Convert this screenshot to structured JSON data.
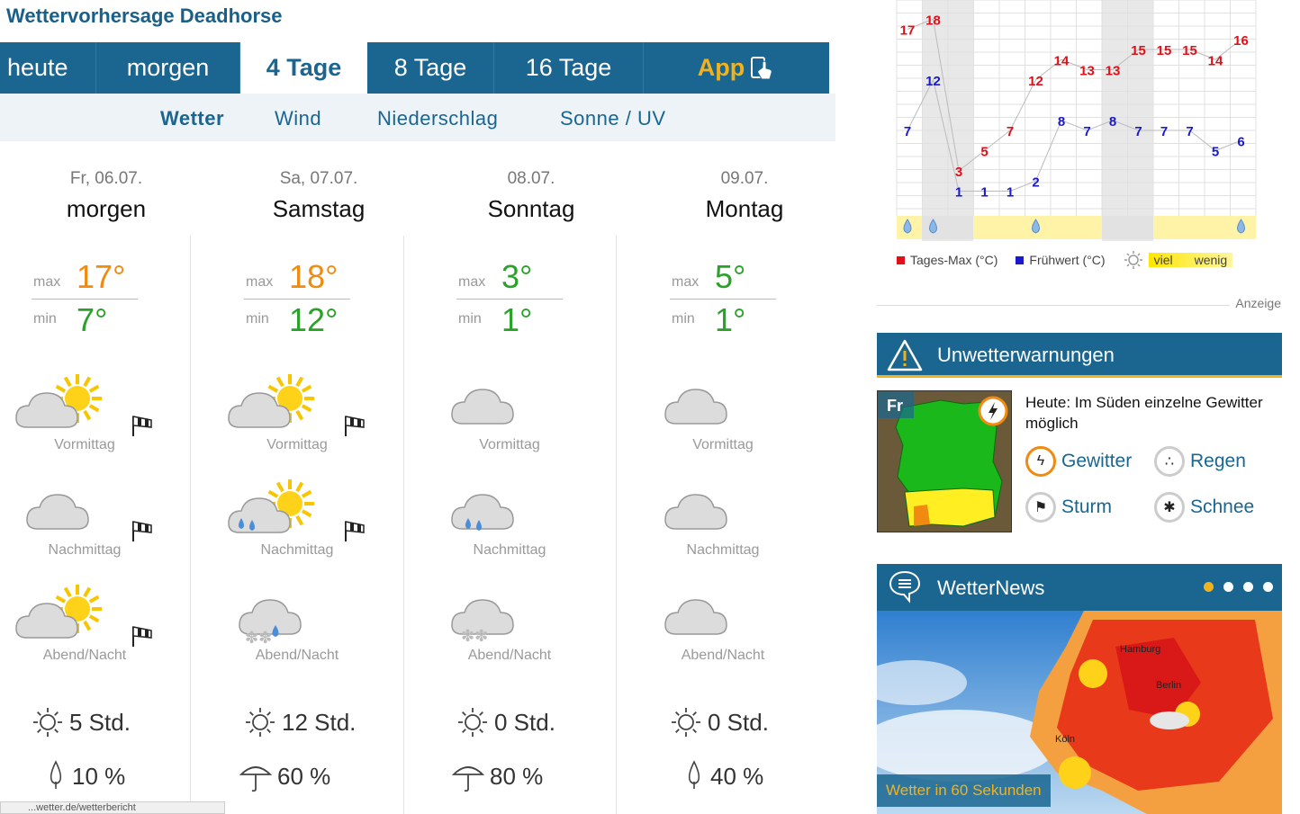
{
  "page": {
    "title": "Wettervorhersage Deadhorse"
  },
  "tabs": [
    {
      "label": "heute"
    },
    {
      "label": "morgen"
    },
    {
      "label": "4 Tage"
    },
    {
      "label": "8 Tage"
    },
    {
      "label": "16 Tage"
    },
    {
      "label": "App"
    }
  ],
  "subtabs": [
    {
      "label": "Wetter"
    },
    {
      "label": "Wind"
    },
    {
      "label": "Niederschlag"
    },
    {
      "label": "Sonne / UV"
    }
  ],
  "labels": {
    "max": "max",
    "min": "min"
  },
  "days": [
    {
      "date": "Fr, 06.07.",
      "name": "morgen",
      "max": "17°",
      "min": "7°",
      "periods": [
        "Vormittag",
        "Nachmittag",
        "Abend/Nacht"
      ],
      "icons": [
        "sun-cloud-icon",
        "cloud-icon",
        "sun-cloud-icon"
      ],
      "wind_icons": [
        "windsock-icon",
        "windsock-icon",
        "windsock-icon"
      ],
      "sun": "5 Std.",
      "rain": "10 %",
      "rain_icon": "drop-icon"
    },
    {
      "date": "Sa, 07.07.",
      "name": "Samstag",
      "max": "18°",
      "min": "12°",
      "periods": [
        "Vormittag",
        "Nachmittag",
        "Abend/Nacht"
      ],
      "icons": [
        "sun-cloud-icon",
        "sun-cloud-rain-icon",
        "cloud-snow-rain-icon"
      ],
      "wind_icons": [
        "windsock-icon",
        "windsock-icon"
      ],
      "sun": "12 Std.",
      "rain": "60 %",
      "rain_icon": "umbrella-icon"
    },
    {
      "date": "08.07.",
      "name": "Sonntag",
      "max": "3°",
      "min": "1°",
      "periods": [
        "Vormittag",
        "Nachmittag",
        "Abend/Nacht"
      ],
      "icons": [
        "cloud-icon",
        "cloud-rain-icon",
        "cloud-snow-icon"
      ],
      "sun": "0 Std.",
      "rain": "80 %",
      "rain_icon": "umbrella-icon"
    },
    {
      "date": "09.07.",
      "name": "Montag",
      "max": "5°",
      "min": "1°",
      "periods": [
        "Vormittag",
        "Nachmittag",
        "Abend/Nacht"
      ],
      "icons": [
        "cloud-icon",
        "cloud-icon",
        "cloud-icon"
      ],
      "sun": "0 Std.",
      "rain": "40 %",
      "rain_icon": "drop-icon"
    }
  ],
  "chart_data": {
    "type": "line",
    "series": [
      {
        "name": "Tages-Max (°C)",
        "values": [
          17,
          18,
          3,
          5,
          7,
          12,
          14,
          13,
          13,
          15,
          15,
          15,
          14,
          16
        ]
      },
      {
        "name": "Frühwert (°C)",
        "values": [
          7,
          12,
          1,
          1,
          1,
          2,
          8,
          7,
          8,
          7,
          7,
          7,
          5,
          6
        ]
      }
    ],
    "precip_icons": [
      "drop-icon",
      "snowdrop-icon",
      "",
      "",
      "",
      "drop-icon",
      "",
      "",
      "",
      "",
      "",
      "",
      "",
      "drop-icon"
    ],
    "legend": {
      "max": "Tages-Max (°C)",
      "early": "Frühwert (°C)",
      "viel": "viel",
      "wenig": "wenig"
    },
    "colors": {
      "max": "#e0101a",
      "early": "#1a1acc"
    }
  },
  "anzeige": "Anzeige",
  "warnings": {
    "title": "Unwetterwarnungen",
    "map_label": "Fr",
    "text": "Heute: Im Süden einzelne Gewitter möglich",
    "items": [
      {
        "label": "Gewitter",
        "icon": "lightning-icon"
      },
      {
        "label": "Regen",
        "icon": "rain-icon"
      },
      {
        "label": "Sturm",
        "icon": "storm-icon"
      },
      {
        "label": "Schnee",
        "icon": "snow-icon"
      }
    ]
  },
  "news": {
    "title": "WetterNews",
    "caption": "Wetter in 60 Sekunden",
    "cities": [
      "Hamburg",
      "Berlin",
      "Köln"
    ]
  },
  "status": {
    "url": "...wetter.de/wetterbericht"
  }
}
